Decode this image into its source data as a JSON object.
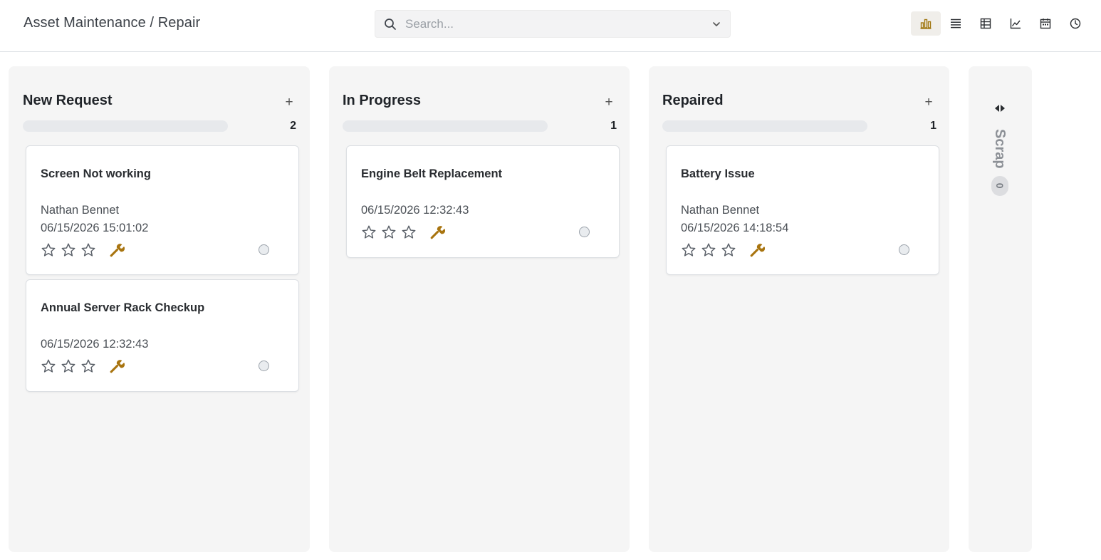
{
  "header": {
    "breadcrumb": "Asset Maintenance / Repair",
    "search": {
      "placeholder": "Search...",
      "value": ""
    },
    "views": [
      {
        "name": "kanban",
        "icon": "kanban-icon",
        "active": true
      },
      {
        "name": "list",
        "icon": "list-icon",
        "active": false
      },
      {
        "name": "pivot",
        "icon": "pivot-icon",
        "active": false
      },
      {
        "name": "graph",
        "icon": "graph-icon",
        "active": false
      },
      {
        "name": "calendar",
        "icon": "calendar-icon",
        "active": false
      },
      {
        "name": "activity",
        "icon": "clock-icon",
        "active": false
      }
    ]
  },
  "board": {
    "columns": [
      {
        "title": "New Request",
        "add_label": "+",
        "count": "2",
        "cards": [
          {
            "title": "Screen Not working",
            "user": "Nathan Bennet",
            "date": "06/15/2026 15:01:02",
            "priority_stars": 0
          },
          {
            "title": "Annual Server Rack Checkup",
            "user": "",
            "date": "06/15/2026 12:32:43",
            "priority_stars": 0
          }
        ]
      },
      {
        "title": "In Progress",
        "add_label": "+",
        "count": "1",
        "cards": [
          {
            "title": "Engine Belt Replacement",
            "user": "",
            "date": "06/15/2026 12:32:43",
            "priority_stars": 0
          }
        ]
      },
      {
        "title": "Repaired",
        "add_label": "+",
        "count": "1",
        "cards": [
          {
            "title": "Battery Issue",
            "user": "Nathan Bennet",
            "date": "06/15/2026 14:18:54",
            "priority_stars": 0
          }
        ]
      }
    ],
    "folded_column": {
      "title": "Scrap",
      "count": "0"
    }
  },
  "colors": {
    "accent": "#a07610",
    "wrench": "#a8740f",
    "column_bg": "#f5f5f5"
  }
}
